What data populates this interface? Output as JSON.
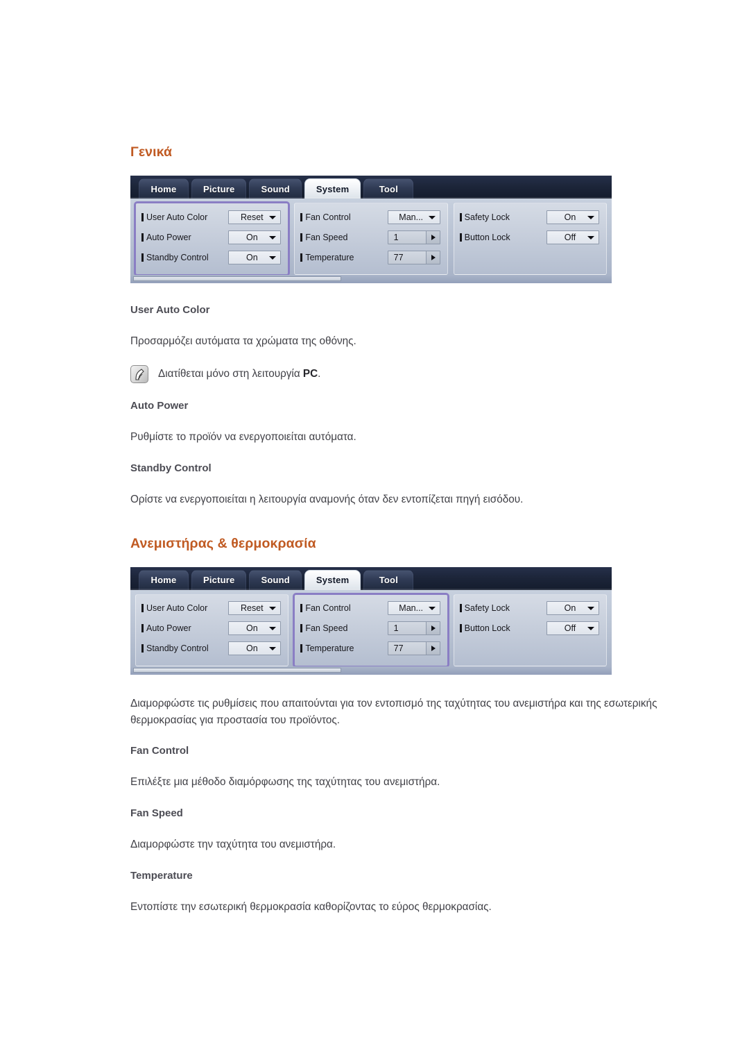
{
  "sections": [
    {
      "heading": "Γενικά",
      "osd": {
        "tabs": [
          {
            "label": "Home",
            "active": false
          },
          {
            "label": "Picture",
            "active": false
          },
          {
            "label": "Sound",
            "active": false
          },
          {
            "label": "System",
            "active": true
          },
          {
            "label": "Tool",
            "active": false
          }
        ],
        "columns": [
          {
            "highlighted": true,
            "rows": [
              {
                "label": "User Auto Color",
                "value": "Reset",
                "control": "dropdown"
              },
              {
                "label": "Auto Power",
                "value": "On",
                "control": "dropdown"
              },
              {
                "label": "Standby Control",
                "value": "On",
                "control": "dropdown"
              }
            ]
          },
          {
            "highlighted": false,
            "rows": [
              {
                "label": "Fan Control",
                "value": "Man...",
                "control": "dropdown"
              },
              {
                "label": "Fan Speed",
                "value": "1",
                "control": "stepper"
              },
              {
                "label": "Temperature",
                "value": "77",
                "control": "stepper"
              }
            ]
          },
          {
            "highlighted": false,
            "rows": [
              {
                "label": "Safety Lock",
                "value": "On",
                "control": "dropdown"
              },
              {
                "label": "Button Lock",
                "value": "Off",
                "control": "dropdown"
              }
            ]
          }
        ]
      },
      "blocks": [
        {
          "type": "subheading",
          "text": "User Auto Color"
        },
        {
          "type": "paragraph",
          "text": "Προσαρμόζει αυτόματα τα χρώματα της οθόνης."
        },
        {
          "type": "note",
          "text_before": "Διατίθεται μόνο στη λειτουργία ",
          "text_bold": "PC",
          "text_after": "."
        },
        {
          "type": "subheading",
          "text": "Auto Power"
        },
        {
          "type": "paragraph",
          "text": "Ρυθμίστε το προϊόν να ενεργοποιείται αυτόματα."
        },
        {
          "type": "subheading",
          "text": "Standby Control"
        },
        {
          "type": "paragraph",
          "text": "Ορίστε να ενεργοποιείται η λειτουργία αναμονής όταν δεν εντοπίζεται πηγή εισόδου."
        }
      ]
    },
    {
      "heading": "Ανεμιστήρας & θερμοκρασία",
      "osd": {
        "tabs": [
          {
            "label": "Home",
            "active": false
          },
          {
            "label": "Picture",
            "active": false
          },
          {
            "label": "Sound",
            "active": false
          },
          {
            "label": "System",
            "active": true
          },
          {
            "label": "Tool",
            "active": false
          }
        ],
        "columns": [
          {
            "highlighted": false,
            "rows": [
              {
                "label": "User Auto Color",
                "value": "Reset",
                "control": "dropdown"
              },
              {
                "label": "Auto Power",
                "value": "On",
                "control": "dropdown"
              },
              {
                "label": "Standby Control",
                "value": "On",
                "control": "dropdown"
              }
            ]
          },
          {
            "highlighted": true,
            "rows": [
              {
                "label": "Fan Control",
                "value": "Man...",
                "control": "dropdown"
              },
              {
                "label": "Fan Speed",
                "value": "1",
                "control": "stepper"
              },
              {
                "label": "Temperature",
                "value": "77",
                "control": "stepper"
              }
            ]
          },
          {
            "highlighted": false,
            "rows": [
              {
                "label": "Safety Lock",
                "value": "On",
                "control": "dropdown"
              },
              {
                "label": "Button Lock",
                "value": "Off",
                "control": "dropdown"
              }
            ]
          }
        ]
      },
      "blocks": [
        {
          "type": "paragraph",
          "text": "Διαμορφώστε τις ρυθμίσεις που απαιτούνται για τον εντοπισμό της ταχύτητας του ανεμιστήρα και της εσωτερικής θερμοκρασίας για προστασία του προϊόντος."
        },
        {
          "type": "subheading",
          "text": "Fan Control"
        },
        {
          "type": "paragraph",
          "text": "Επιλέξτε μια μέθοδο διαμόρφωσης της ταχύτητας του ανεμιστήρα."
        },
        {
          "type": "subheading",
          "text": "Fan Speed"
        },
        {
          "type": "paragraph",
          "text": "Διαμορφώστε την ταχύτητα του ανεμιστήρα."
        },
        {
          "type": "subheading",
          "text": "Temperature"
        },
        {
          "type": "paragraph",
          "text": "Εντοπίστε την εσωτερική θερμοκρασία καθορίζοντας το εύρος θερμοκρασίας."
        }
      ]
    }
  ],
  "colors": {
    "heading": "#C05A22",
    "subheading": "#4C4C54",
    "body": "#3F3F45",
    "highlight_outline": "#8A7EC4",
    "osd_tabbar": "#1C2539"
  },
  "icons": {
    "note": "note-pen-icon"
  }
}
